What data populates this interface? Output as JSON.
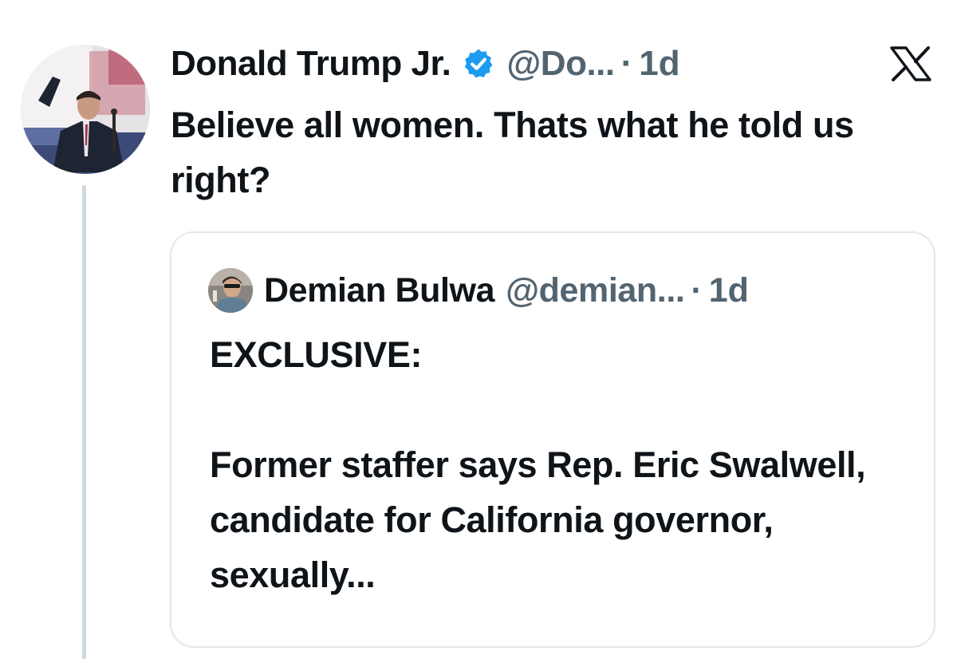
{
  "tweet": {
    "display_name": "Donald Trump Jr.",
    "handle": "@Do...",
    "separator": "·",
    "time": "1d",
    "verified": true,
    "text": "Believe all women. Thats what he told us right?"
  },
  "quote": {
    "display_name": "Demian Bulwa",
    "handle": "@demian...",
    "separator": "·",
    "time": "1d",
    "text": "EXCLUSIVE:\n\nFormer staffer says Rep. Eric Swalwell, candidate for California governor, sexually..."
  },
  "icons": {
    "verified": "verified-check-icon",
    "brand": "x-logo-icon"
  },
  "colors": {
    "text": "#0f1419",
    "muted": "#536471",
    "verified": "#1d9bf0",
    "border": "#e1e8ed",
    "thread_line": "#cfd9de"
  }
}
